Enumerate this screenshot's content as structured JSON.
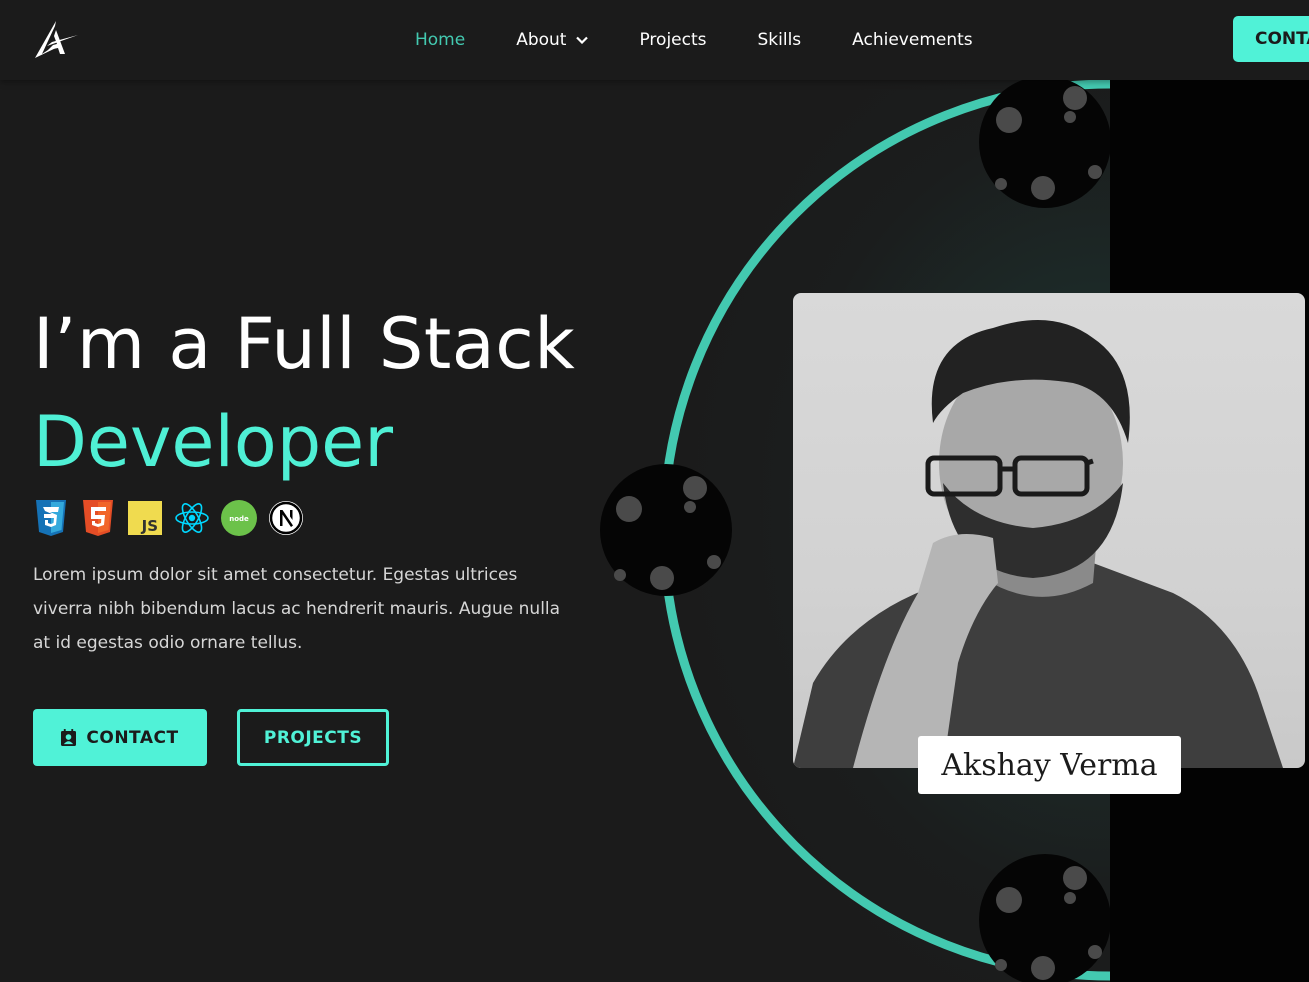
{
  "nav": {
    "logo_icon": "akshay-logo-icon",
    "links": [
      {
        "label": "Home",
        "active": true
      },
      {
        "label": "About",
        "has_dropdown": true
      },
      {
        "label": "Projects"
      },
      {
        "label": "Skills"
      },
      {
        "label": "Achievements"
      }
    ],
    "contact_label": "CONTACT",
    "contact_icon": "contact-card-icon"
  },
  "hero": {
    "title_line1": "I’m a Full Stack",
    "title_line2": "Developer",
    "tech_icons": [
      "css3-icon",
      "html5-icon",
      "javascript-icon",
      "react-icon",
      "nodejs-icon",
      "nextjs-icon"
    ],
    "tech_labels": {
      "js": "JS",
      "node": "node",
      "next": "N"
    },
    "description": "Lorem ipsum dolor sit amet consectetur. Egestas ultrices viverra nibh bibendum lacus ac hendrerit mauris. Augue nulla at id egestas odio ornare tellus.",
    "contact_button": "CONTACT",
    "projects_button": "PROJECTS"
  },
  "profile": {
    "name": "Akshay Verma",
    "photo": "portrait-photo"
  },
  "colors": {
    "accent": "#50f2d7",
    "accent_dark": "#43c9b0",
    "background": "#1b1b1b",
    "dark_column": "#030303",
    "crater": "#4a4a4a"
  }
}
